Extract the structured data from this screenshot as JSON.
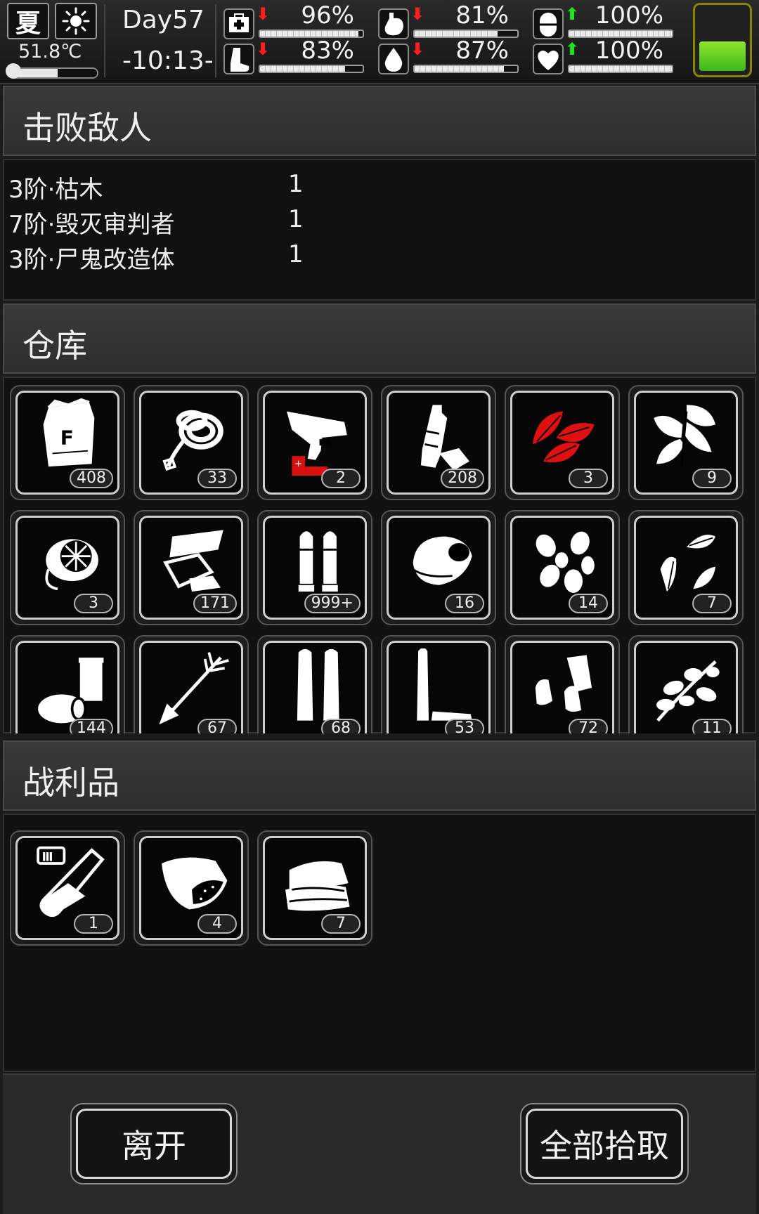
{
  "status": {
    "season": "夏",
    "weather_icon": "sun-icon",
    "temperature": "51.8℃",
    "temperature_level": 0.55,
    "day": "Day57",
    "time": "-10:13-",
    "battery_level": 0.42,
    "battery_color": "#5fd321",
    "stats": [
      {
        "name": "health",
        "icon": "medkit-icon",
        "trend": "down",
        "trend_glyph": "⬇",
        "percent": "96%",
        "level": 0.96
      },
      {
        "name": "hunger",
        "icon": "stomach-icon",
        "trend": "down",
        "trend_glyph": "⬇",
        "percent": "81%",
        "level": 0.81
      },
      {
        "name": "mood",
        "icon": "pill-icon",
        "trend": "up",
        "trend_glyph": "⬆",
        "percent": "100%",
        "level": 1.0
      },
      {
        "name": "stamina",
        "icon": "foot-icon",
        "trend": "down",
        "trend_glyph": "⬇",
        "percent": "83%",
        "level": 0.83
      },
      {
        "name": "thirst",
        "icon": "water-drop-icon",
        "trend": "down",
        "trend_glyph": "⬇",
        "percent": "87%",
        "level": 0.87
      },
      {
        "name": "spirit",
        "icon": "heart-icon",
        "trend": "up",
        "trend_glyph": "⬆",
        "percent": "100%",
        "level": 1.0
      }
    ]
  },
  "defeated": {
    "title": "击败敌人",
    "enemies": [
      {
        "name": "3阶·枯木",
        "count": "1"
      },
      {
        "name": "7阶·毁灭审判者",
        "count": "1"
      },
      {
        "name": "3阶·尸鬼改造体",
        "count": "1"
      }
    ]
  },
  "warehouse": {
    "title": "仓库",
    "items": [
      {
        "icon": "flour-bag-icon",
        "count": "408"
      },
      {
        "icon": "rope-icon",
        "count": "33"
      },
      {
        "icon": "flare-gun-icon",
        "count": "2"
      },
      {
        "icon": "plastic-bottle-icon",
        "count": "208"
      },
      {
        "icon": "red-herb-icon",
        "count": "3"
      },
      {
        "icon": "mint-leaf-icon",
        "count": "9"
      },
      {
        "icon": "gas-mask-filter-icon",
        "count": "3"
      },
      {
        "icon": "scrap-metal-icon",
        "count": "171"
      },
      {
        "icon": "pistol-ammo-icon",
        "count": "999+"
      },
      {
        "icon": "raw-meat-icon",
        "count": "16"
      },
      {
        "icon": "seeds-icon",
        "count": "14"
      },
      {
        "icon": "sunflower-seeds-icon",
        "count": "7"
      },
      {
        "icon": "cans-icon",
        "count": "144"
      },
      {
        "icon": "arrow-icon",
        "count": "67"
      },
      {
        "icon": "rifle-ammo-icon",
        "count": "68"
      },
      {
        "icon": "sniper-ammo-icon",
        "count": "53"
      },
      {
        "icon": "shotgun-shells-icon",
        "count": "72"
      },
      {
        "icon": "herb-branch-icon",
        "count": "11"
      }
    ]
  },
  "loot": {
    "title": "战利品",
    "items": [
      {
        "icon": "test-tube-icon",
        "count": "1",
        "tier": "III"
      },
      {
        "icon": "rotten-meat-icon",
        "count": "4"
      },
      {
        "icon": "cloth-icon",
        "count": "7"
      }
    ]
  },
  "buttons": {
    "leave": "离开",
    "pick_all": "全部拾取"
  },
  "colors": {
    "arrow_down": "#ff1d1d",
    "arrow_up": "#1ee51e",
    "herb_red": "#e01010",
    "battery_frame": "#8a8400"
  }
}
